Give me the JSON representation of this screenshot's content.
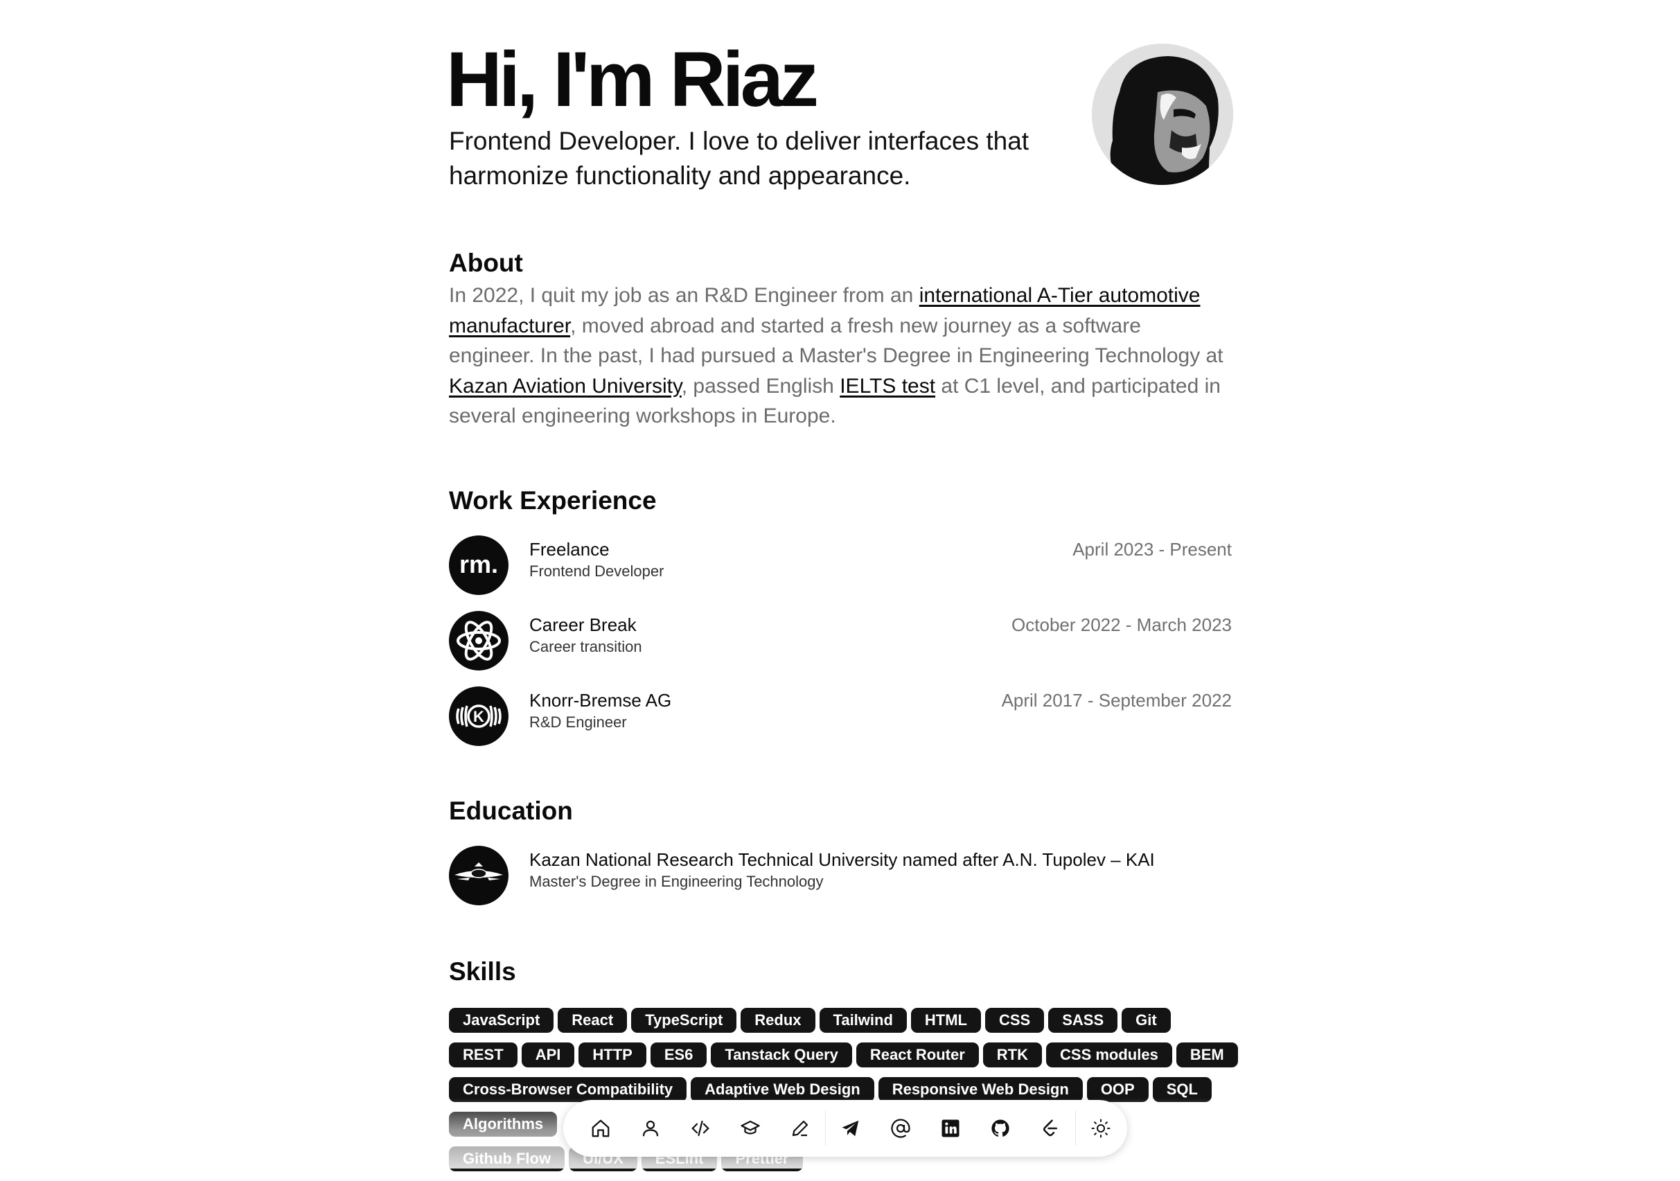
{
  "hero": {
    "title": "Hi, I'm Riaz",
    "subtitle_line1": "Frontend Developer. I love to deliver interfaces that",
    "subtitle_line2": "harmonize functionality and appearance."
  },
  "about": {
    "heading": "About",
    "t1": "In 2022, I quit my job as an R&D Engineer from an ",
    "link1": "international A-Tier automotive manufacturer",
    "t2": ", moved abroad and started a fresh new journey as a software engineer. In the past, I had pursued a Master's Degree in Engineering Technology at ",
    "link2": "Kazan Aviation University",
    "t3": ", passed English ",
    "link3": "IELTS test",
    "t4": " at C1 level, and participated in several engineering workshops in Europe."
  },
  "work": {
    "heading": "Work Experience",
    "items": [
      {
        "name": "Freelance",
        "role": "Frontend Developer",
        "period": "April 2023 - Present",
        "logo_text": "rm."
      },
      {
        "name": "Career Break",
        "role": "Career transition",
        "period": "October 2022 - March 2023",
        "logo_text": ""
      },
      {
        "name": "Knorr-Bremse AG",
        "role": "R&D Engineer",
        "period": "April 2017 - September 2022",
        "logo_text": "K"
      }
    ]
  },
  "education": {
    "heading": "Education",
    "items": [
      {
        "name": "Kazan National Research Technical University named after A.N. Tupolev – KAI",
        "degree": "Master's Degree in Engineering Technology"
      }
    ]
  },
  "skills": {
    "heading": "Skills",
    "rows": [
      [
        "JavaScript",
        "React",
        "TypeScript",
        "Redux",
        "Tailwind",
        "HTML",
        "CSS",
        "SASS",
        "Git"
      ],
      [
        "REST",
        "API",
        "HTTP",
        "ES6",
        "Tanstack Query",
        "React Router",
        "RTK",
        "CSS modules",
        "BEM"
      ],
      [
        "Cross-Browser Compatibility",
        "Adaptive Web Design",
        "Responsive Web Design",
        "OOP",
        "SQL"
      ],
      [
        "Algorithms"
      ],
      [
        "Github Flow",
        "UI/UX",
        "ESLint",
        "Prettier"
      ]
    ]
  },
  "dock": {
    "items": [
      "home-icon",
      "user-icon",
      "code-icon",
      "graduation-cap-icon",
      "pencil-icon",
      "telegram-icon",
      "at-sign-icon",
      "linkedin-icon",
      "github-icon",
      "leetcode-icon",
      "sun-icon"
    ]
  }
}
